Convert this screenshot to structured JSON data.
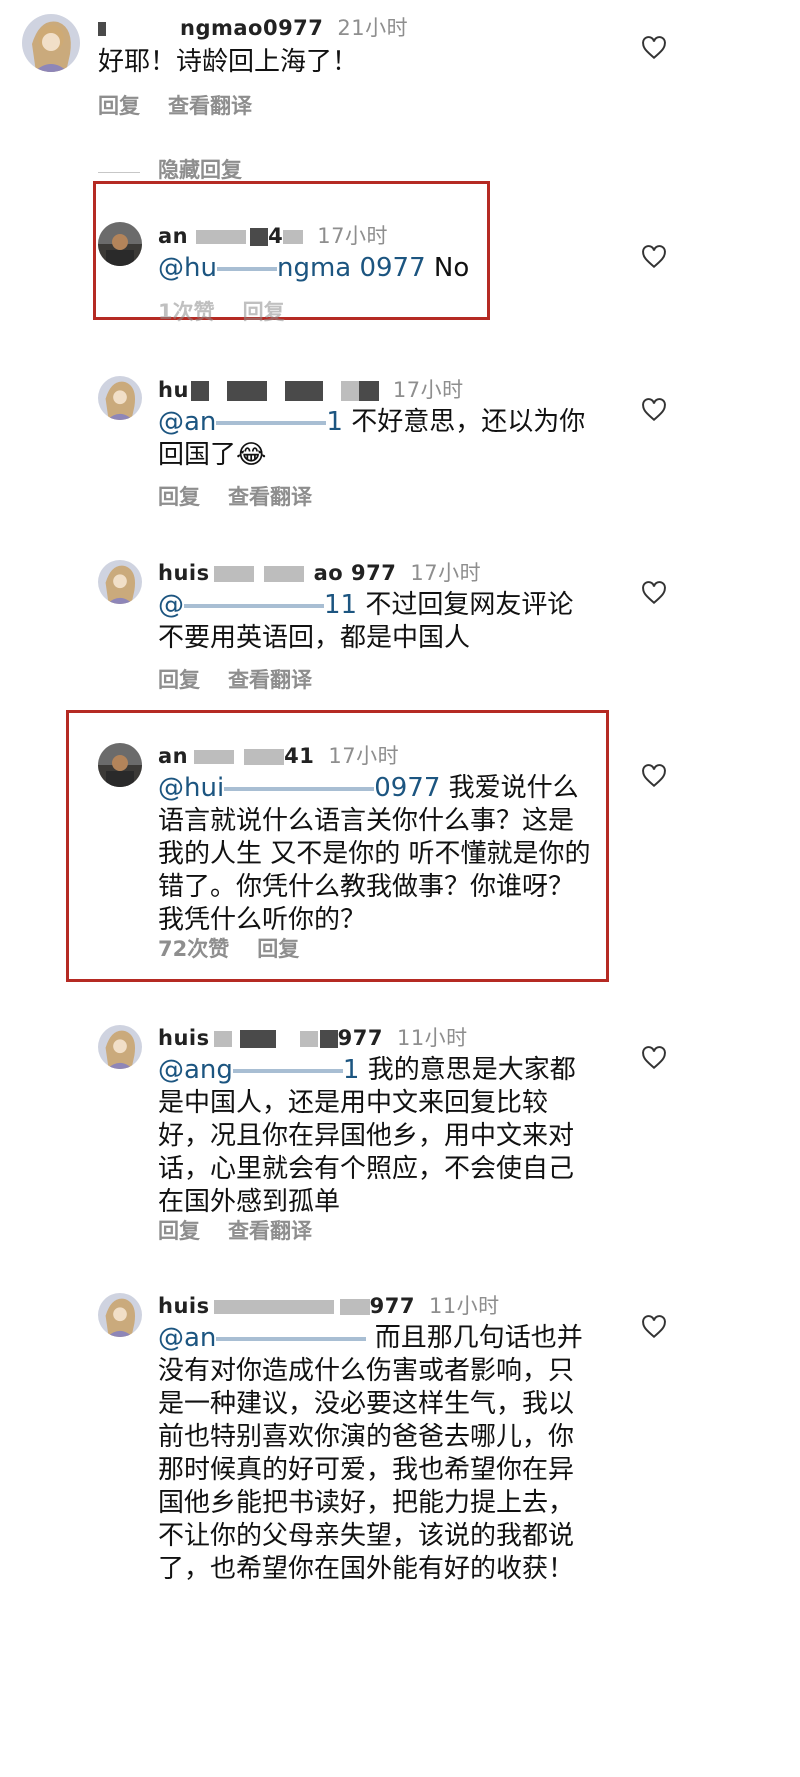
{
  "comments": [
    {
      "username": "ngmao0977",
      "time": "21小时",
      "text": "好耶！诗龄回上海了！",
      "actions": [
        "回复",
        "查看翻译"
      ],
      "avatar": "anime-avatar"
    },
    {
      "username": "an",
      "username_tail": "4",
      "time": "17小时",
      "mention": "@hu",
      "mention_tail": "ngma   0977",
      "text": "No",
      "actions": [
        "1次赞",
        "回复"
      ],
      "avatar": "photo-avatar"
    },
    {
      "username": "hu",
      "time": "17小时",
      "mention": "@an",
      "mention_tail": "1",
      "text": "不好意思，还以为你回国了😂",
      "actions": [
        "回复",
        "查看翻译"
      ],
      "avatar": "anime-avatar"
    },
    {
      "username": "huis",
      "username_tail": "ao 977",
      "time": "17小时",
      "mention": "@",
      "mention_tail": "11",
      "text": "不过回复网友评论不要用英语回，都是中国人",
      "actions": [
        "回复",
        "查看翻译"
      ],
      "avatar": "anime-avatar"
    },
    {
      "username": "an",
      "username_tail": "41",
      "time": "17小时",
      "mention": "@hui",
      "mention_tail": "0977",
      "text": "我爱说什么语言就说什么语言关你什么事？这是我的人生 又不是你的 听不懂就是你的错了。你凭什么教我做事？你谁呀？我凭什么听你的？",
      "actions": [
        "72次赞",
        "回复"
      ],
      "avatar": "photo-avatar"
    },
    {
      "username": "huis",
      "username_tail": "977",
      "time": "11小时",
      "mention": "@ang",
      "mention_tail": "1",
      "text": "我的意思是大家都是中国人，还是用中文来回复比较好，况且你在异国他乡，用中文来对话，心里就会有个照应，不会使自己在国外感到孤单",
      "actions": [
        "回复",
        "查看翻译"
      ],
      "avatar": "anime-avatar"
    },
    {
      "username": "huis",
      "username_tail": "977",
      "time": "11小时",
      "mention": "@an",
      "mention_tail": "",
      "text": "而且那几句话也并没有对你造成什么伤害或者影响，只是一种建议，没必要这样生气，我以前也特别喜欢你演的爸爸去哪儿，你那时候真的好可爱，我也希望你在异国他乡能把书读好，把能力提上去，不让你的父母亲失望，该说的我都说了，也希望你在国外能有好的收获！",
      "actions": [],
      "avatar": "anime-avatar"
    }
  ],
  "hidden_replies_label": "隐藏回复",
  "colors": {
    "highlight_box": "#b52a23",
    "mention": "#1c5580",
    "meta": "#8e8e8e"
  }
}
